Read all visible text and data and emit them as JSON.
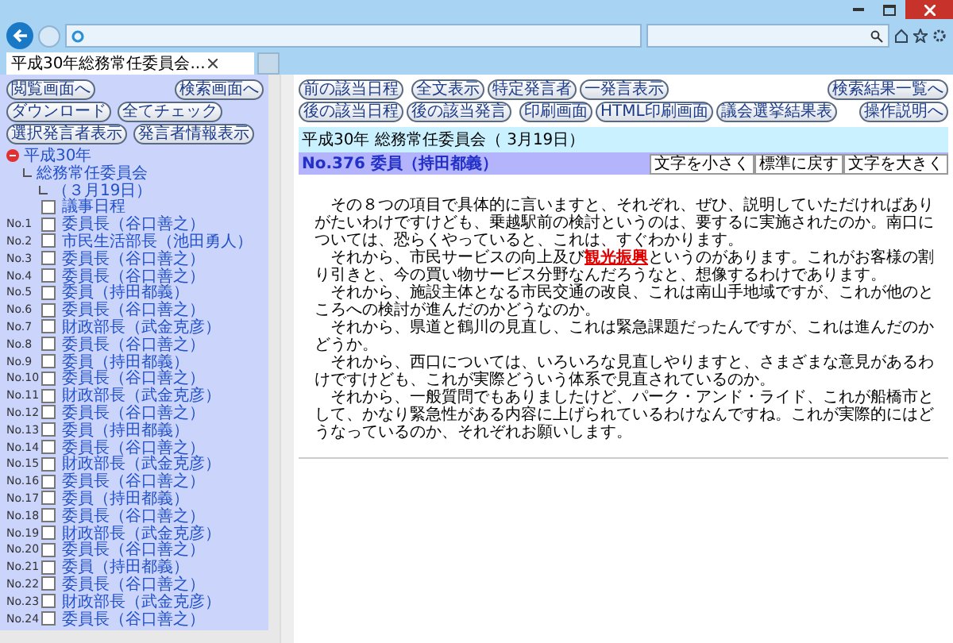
{
  "window": {
    "tab_title": "平成30年総務常任委員会..."
  },
  "sidebar": {
    "buttons": [
      {
        "label": "閲覧画面へ",
        "kind": "pair"
      },
      {
        "label": "検索画面へ",
        "kind": "pair"
      },
      {
        "label": "ダウンロード",
        "kind": "row"
      },
      {
        "label": "全てチェック",
        "kind": "row"
      },
      {
        "label": "選択発言者表示",
        "kind": "row"
      },
      {
        "label": "発言者情報表示",
        "kind": "row"
      }
    ],
    "tree": [
      {
        "label": "平成30年",
        "expanded": true,
        "children": [
          {
            "label": "総務常任委員会",
            "children": [
              {
                "label": "（３月19日）"
              }
            ]
          }
        ]
      }
    ],
    "agenda": {
      "label": "議事日程",
      "checked": false
    },
    "speeches": [
      {
        "number": "No.1",
        "speaker": "委員長（谷口善之）",
        "checked": false
      },
      {
        "number": "No.2",
        "speaker": "市民生活部長（池田勇人）",
        "checked": false
      },
      {
        "number": "No.3",
        "speaker": "委員長（谷口善之）",
        "checked": false
      },
      {
        "number": "No.4",
        "speaker": "委員長（谷口善之）",
        "checked": false
      },
      {
        "number": "No.5",
        "speaker": "委員（持田都義）",
        "checked": false
      },
      {
        "number": "No.6",
        "speaker": "委員長（谷口善之）",
        "checked": false
      },
      {
        "number": "No.7",
        "speaker": "財政部長（武金克彦）",
        "checked": false
      },
      {
        "number": "No.8",
        "speaker": "委員長（谷口善之）",
        "checked": false
      },
      {
        "number": "No.9",
        "speaker": "委員（持田都義）",
        "checked": false
      },
      {
        "number": "No.10",
        "speaker": "委員長（谷口善之）",
        "checked": false
      },
      {
        "number": "No.11",
        "speaker": "財政部長（武金克彦）",
        "checked": false
      },
      {
        "number": "No.12",
        "speaker": "委員長（谷口善之）",
        "checked": false
      },
      {
        "number": "No.13",
        "speaker": "委員（持田都義）",
        "checked": false
      },
      {
        "number": "No.14",
        "speaker": "委員長（谷口善之）",
        "checked": false
      },
      {
        "number": "No.15",
        "speaker": "財政部長（武金克彦）",
        "checked": false
      },
      {
        "number": "No.16",
        "speaker": "委員長（谷口善之）",
        "checked": false
      },
      {
        "number": "No.17",
        "speaker": "委員（持田都義）",
        "checked": false
      },
      {
        "number": "No.18",
        "speaker": "委員長（谷口善之）",
        "checked": false
      },
      {
        "number": "No.19",
        "speaker": "財政部長（武金克彦）",
        "checked": false
      },
      {
        "number": "No.20",
        "speaker": "委員長（谷口善之）",
        "checked": false
      },
      {
        "number": "No.21",
        "speaker": "委員（持田都義）",
        "checked": false
      },
      {
        "number": "No.22",
        "speaker": "委員長（谷口善之）",
        "checked": false
      },
      {
        "number": "No.23",
        "speaker": "財政部長（武金克彦）",
        "checked": false
      },
      {
        "number": "No.24",
        "speaker": "委員長（谷口善之）",
        "checked": false
      }
    ]
  },
  "main": {
    "nav_rows": [
      {
        "groups": [
          [
            "前の該当日程"
          ],
          [
            "全文表示",
            "特定発言者",
            "一発言表示"
          ]
        ],
        "side": "検索結果一覧へ"
      },
      {
        "groups": [
          [
            "後の該当日程",
            "後の該当発言"
          ],
          [
            "印刷画面",
            "HTML印刷画面",
            "議会選挙結果表"
          ]
        ],
        "side": "操作説明へ"
      }
    ],
    "session": "平成30年 総務常任委員会（ 3月19日）",
    "speech_title": "No.376 委員（持田都義）",
    "font_buttons": [
      "文字を小さく",
      "標準に戻す",
      "文字を大きく"
    ],
    "lines": [
      "その８つの項目で具体的に言いますと、それぞれ、ぜひ、説明していただければありがたいわけですけども、乗越駅前の検討というのは、要するに実施されたのか。南口については、恐らくやっていると、これは、すぐわかります。",
      "それから、市民サービスの向上及び**観光振興**というのがあります。これがお客様の割り引きと、今の買い物サービス分野なんだろうなと、想像するわけであります。",
      "それから、施設主体となる市民交通の改良、これは南山手地域ですが、これが他のところへの検討が進んだのかどうなのか。",
      "それから、県道と鶴川の見直し、これは緊急課題だったんですが、これは進んだのかどうか。",
      "それから、西口については、いろいろな見直しやりますと、さまざまな意見があるわけですけども、これが実際どういう体系で見直されているのか。",
      "それから、一般質問でもありましたけど、パーク・アンド・ライド、これが船橋市として、かなり緊急性がある内容に上げられているわけなんですね。これが実際的にはどうなっているのか、それぞれお願いします。"
    ]
  }
}
